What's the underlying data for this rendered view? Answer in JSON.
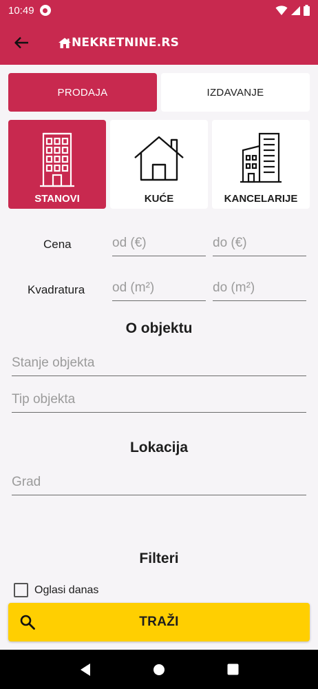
{
  "status_bar": {
    "time": "10:49"
  },
  "app_bar": {
    "logo_text": "NEKRETNINE.RS"
  },
  "transaction_tabs": [
    {
      "label": "PRODAJA",
      "selected": true
    },
    {
      "label": "IZDAVANJE",
      "selected": false
    }
  ],
  "categories": [
    {
      "label": "STANOVI",
      "icon": "apartment-building-icon",
      "selected": true
    },
    {
      "label": "KUĆE",
      "icon": "house-icon",
      "selected": false
    },
    {
      "label": "KANCELARIJE",
      "icon": "office-buildings-icon",
      "selected": false
    }
  ],
  "price": {
    "label": "Cena",
    "from_placeholder": "od (€)",
    "to_placeholder": "do (€)"
  },
  "area": {
    "label": "Kvadratura",
    "from_placeholder": "od (m²)",
    "to_placeholder": "do (m²)"
  },
  "object_section": {
    "title": "O objektu",
    "condition_placeholder": "Stanje objekta",
    "type_placeholder": "Tip objekta"
  },
  "location_section": {
    "title": "Lokacija",
    "city_placeholder": "Grad"
  },
  "filters_section": {
    "title": "Filteri",
    "todays_ads_label": "Oglasi danas",
    "todays_ads_checked": false
  },
  "search_button": {
    "label": "TRAŽI"
  },
  "colors": {
    "brand": "#c8294f",
    "accent": "#ffcf01",
    "background": "#f6f4f7"
  }
}
